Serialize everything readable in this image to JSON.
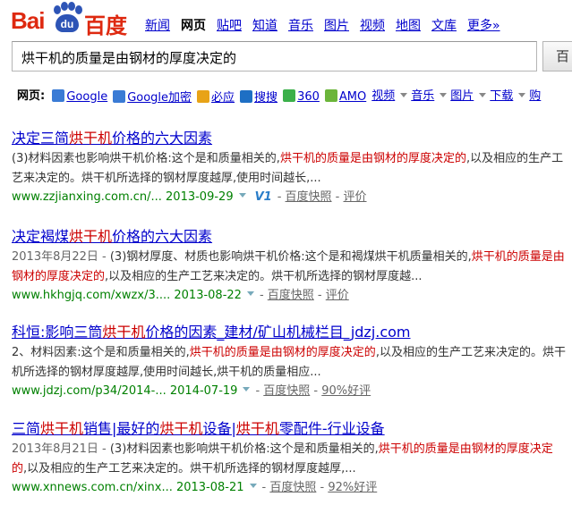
{
  "logo": {
    "bai": "Bai",
    "du": "du",
    "cn": "百度"
  },
  "nav": {
    "items": [
      "新闻",
      "网页",
      "贴吧",
      "知道",
      "音乐",
      "图片",
      "视频",
      "地图",
      "文库",
      "更多»"
    ],
    "active_index": 1
  },
  "search": {
    "query": "烘干机的质量是由钢材的厚度决定的",
    "button_label": "百"
  },
  "webbar": {
    "label": "网页:",
    "items": [
      {
        "label": "Google",
        "icon": "google-icon",
        "color": "#3a7bd5"
      },
      {
        "label": "Google加密",
        "icon": "google-icon",
        "color": "#3a7bd5"
      },
      {
        "label": "必应",
        "icon": "bing-icon",
        "color": "#e8a317"
      },
      {
        "label": "搜搜",
        "icon": "soso-icon",
        "color": "#1e6fc4"
      },
      {
        "label": "360",
        "icon": "360-icon",
        "color": "#3bb04a"
      },
      {
        "label": "AMO",
        "icon": "amo-icon",
        "color": "#6bb53a"
      }
    ],
    "dropdowns": [
      "视频",
      "音乐",
      "图片",
      "下载",
      "购"
    ]
  },
  "results": [
    {
      "title_parts": [
        {
          "text": "决定三简",
          "em": false
        },
        {
          "text": "烘干机",
          "em": true
        },
        {
          "text": "价格的六大因素",
          "em": false
        }
      ],
      "abstract": {
        "date": "",
        "parts": [
          {
            "text": "(3)材料因素也影响烘干机价格:这个是和质量相关的,",
            "em": false
          },
          {
            "text": "烘干机的质量是由钢材的厚度决定的",
            "em": true
          },
          {
            "text": ",以及相应的生产工艺来决定的。烘干机所选择的钢材厚度越厚,使用时间越长,...",
            "em": false
          }
        ]
      },
      "url": "www.zzjianxing.com.cn/...",
      "date": "2013-09-29",
      "v1": "V1",
      "snapshot": "百度快照",
      "rating": "评价"
    },
    {
      "title_parts": [
        {
          "text": "决定褐煤",
          "em": false
        },
        {
          "text": "烘干机",
          "em": true
        },
        {
          "text": "价格的六大因素",
          "em": false
        }
      ],
      "abstract": {
        "date": "2013年8月22日 - ",
        "parts": [
          {
            "text": "(3)钢材厚度、材质也影响烘干机价格:这个是和褐煤烘干机质量相关的,",
            "em": false
          },
          {
            "text": "烘干机的质量是由钢材的厚度决定的",
            "em": true
          },
          {
            "text": ",以及相应的生产工艺来决定的。烘干机所选择的钢材厚度越...",
            "em": false
          }
        ]
      },
      "url": "www.hkhgjq.com/xwzx/3....",
      "date": "2013-08-22",
      "v1": "",
      "snapshot": "百度快照",
      "rating": "评价"
    },
    {
      "title_parts": [
        {
          "text": "科恒:影响三筒",
          "em": false
        },
        {
          "text": "烘干机",
          "em": true
        },
        {
          "text": "价格的因素_建材/矿山机械栏目_jdzj.com",
          "em": false
        }
      ],
      "abstract": {
        "date": "",
        "parts": [
          {
            "text": "2、材料因素:这个是和质量相关的,",
            "em": false
          },
          {
            "text": "烘干机的质量是由钢材的厚度决定的",
            "em": true
          },
          {
            "text": ",以及相应的生产工艺来决定的。烘干机所选择的钢材厚度越厚,使用时间越长,烘干机的质量相应...",
            "em": false
          }
        ]
      },
      "url": "www.jdzj.com/p34/2014-...",
      "date": "2014-07-19",
      "v1": "",
      "snapshot": "百度快照",
      "rating": "90%好评"
    },
    {
      "title_parts": [
        {
          "text": "三简",
          "em": false
        },
        {
          "text": "烘干机",
          "em": true
        },
        {
          "text": "销售|最好的",
          "em": false
        },
        {
          "text": "烘干机",
          "em": true
        },
        {
          "text": "设备|",
          "em": false
        },
        {
          "text": "烘干机",
          "em": true
        },
        {
          "text": "零配件-行业设备",
          "em": false
        }
      ],
      "abstract": {
        "date": "2013年8月21日 - ",
        "parts": [
          {
            "text": "(3)材料因素也影响烘干机价格:这个是和质量相关的,",
            "em": false
          },
          {
            "text": "烘干机的质量是由钢材的厚度决定的",
            "em": true
          },
          {
            "text": ",以及相应的生产工艺来决定的。烘干机所选择的钢材厚度越厚,...",
            "em": false
          }
        ]
      },
      "url": "www.xnnews.com.cn/xinx...",
      "date": "2013-08-21",
      "v1": "",
      "snapshot": "百度快照",
      "rating": "92%好评"
    }
  ]
}
